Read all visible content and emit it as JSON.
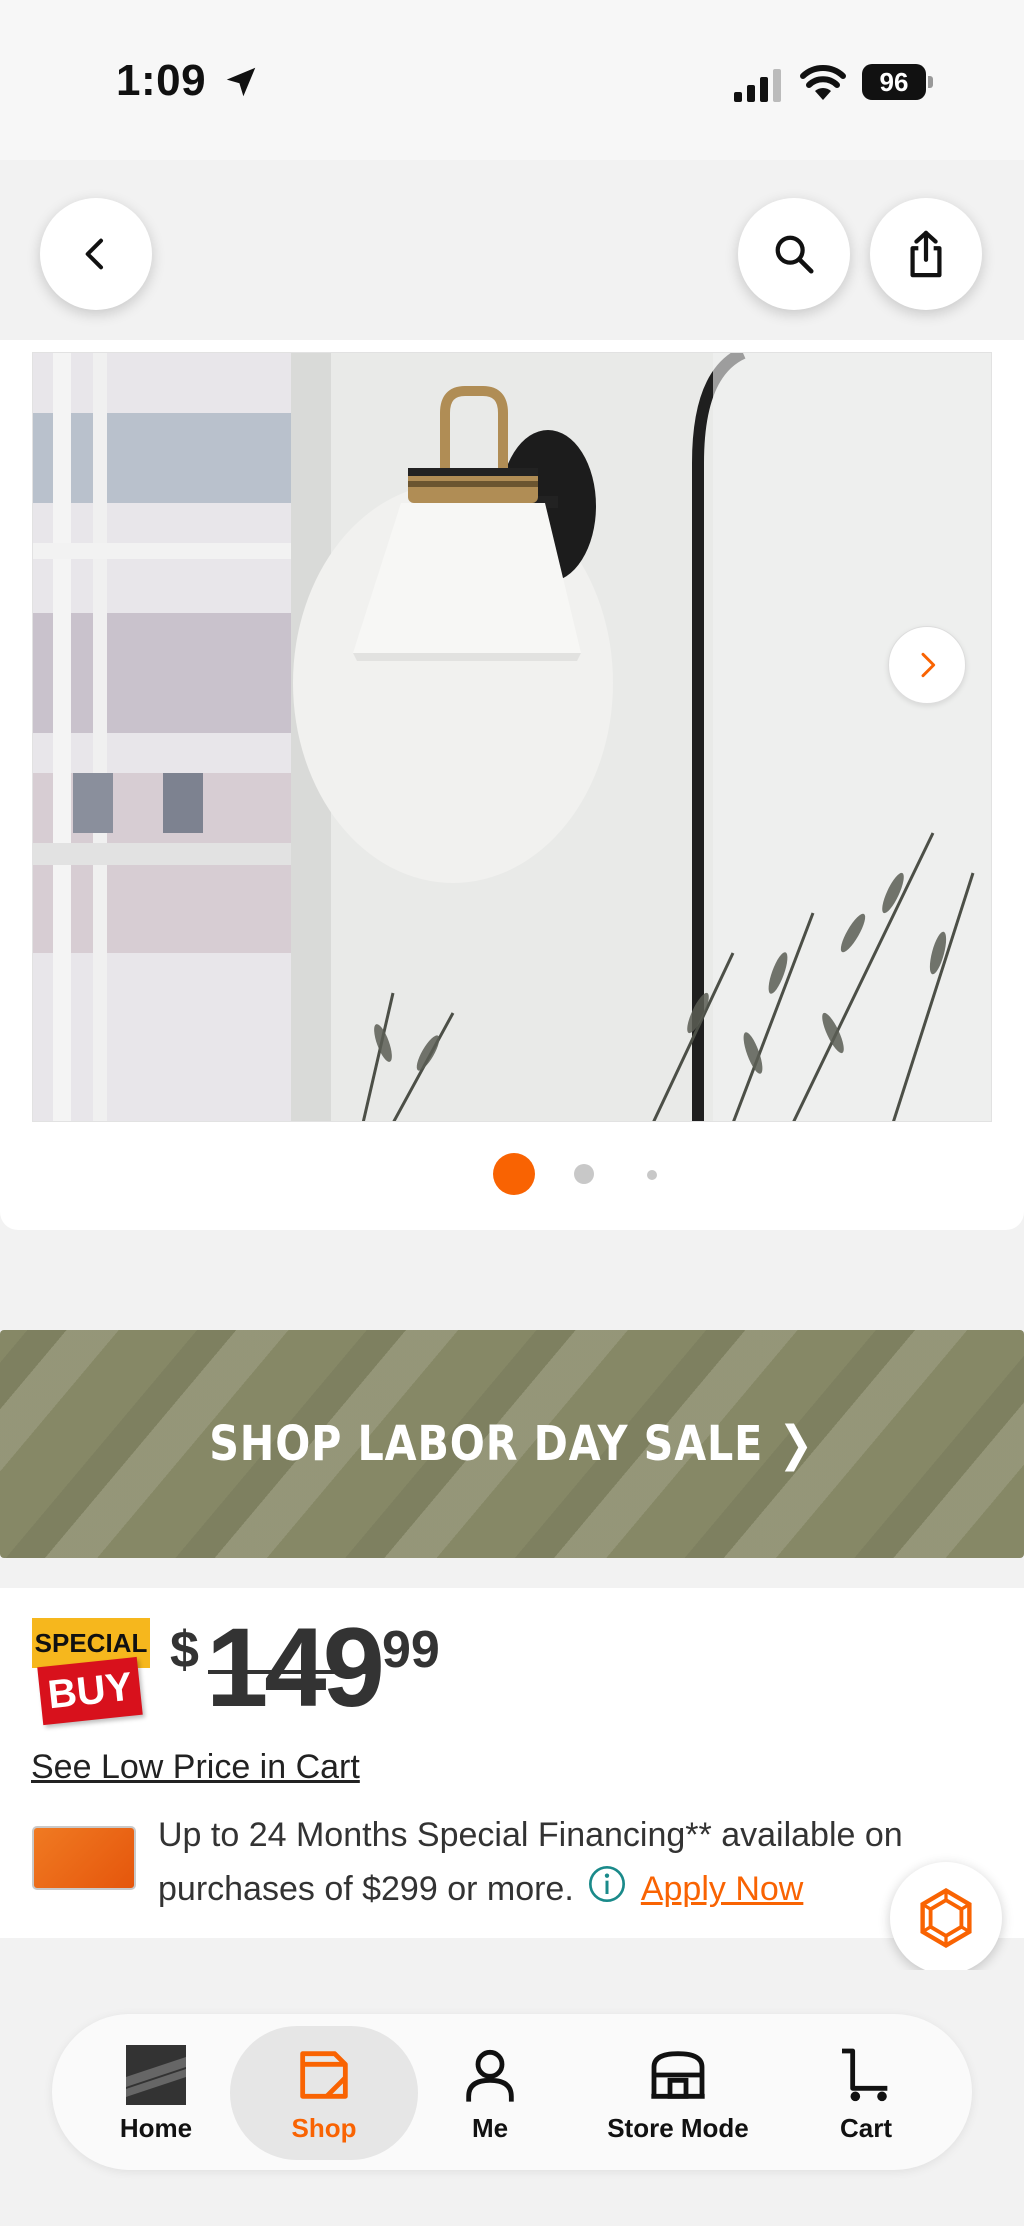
{
  "status_bar": {
    "time": "1:09",
    "battery": "96"
  },
  "promo": {
    "label": "SHOP LABOR DAY SALE ❯"
  },
  "price": {
    "badge_top": "SPECIAL",
    "badge_bottom": "BUY",
    "dollar_sign": "$",
    "whole": "149",
    "cents": "99",
    "low_price_link": "See Low Price in Cart"
  },
  "financing": {
    "text": "Up to 24 Months Special Financing** available on purchases of $299 or more.",
    "apply_label": "Apply Now"
  },
  "carousel": {
    "total_dots": 3,
    "active_index": 0
  },
  "tabs": [
    {
      "label": "Home"
    },
    {
      "label": "Shop"
    },
    {
      "label": "Me"
    },
    {
      "label": "Store Mode"
    },
    {
      "label": "Cart"
    }
  ],
  "colors": {
    "accent": "#f96302",
    "promo_bg": "#868866",
    "special_yellow": "#f6b71d",
    "special_red": "#d8111c"
  }
}
